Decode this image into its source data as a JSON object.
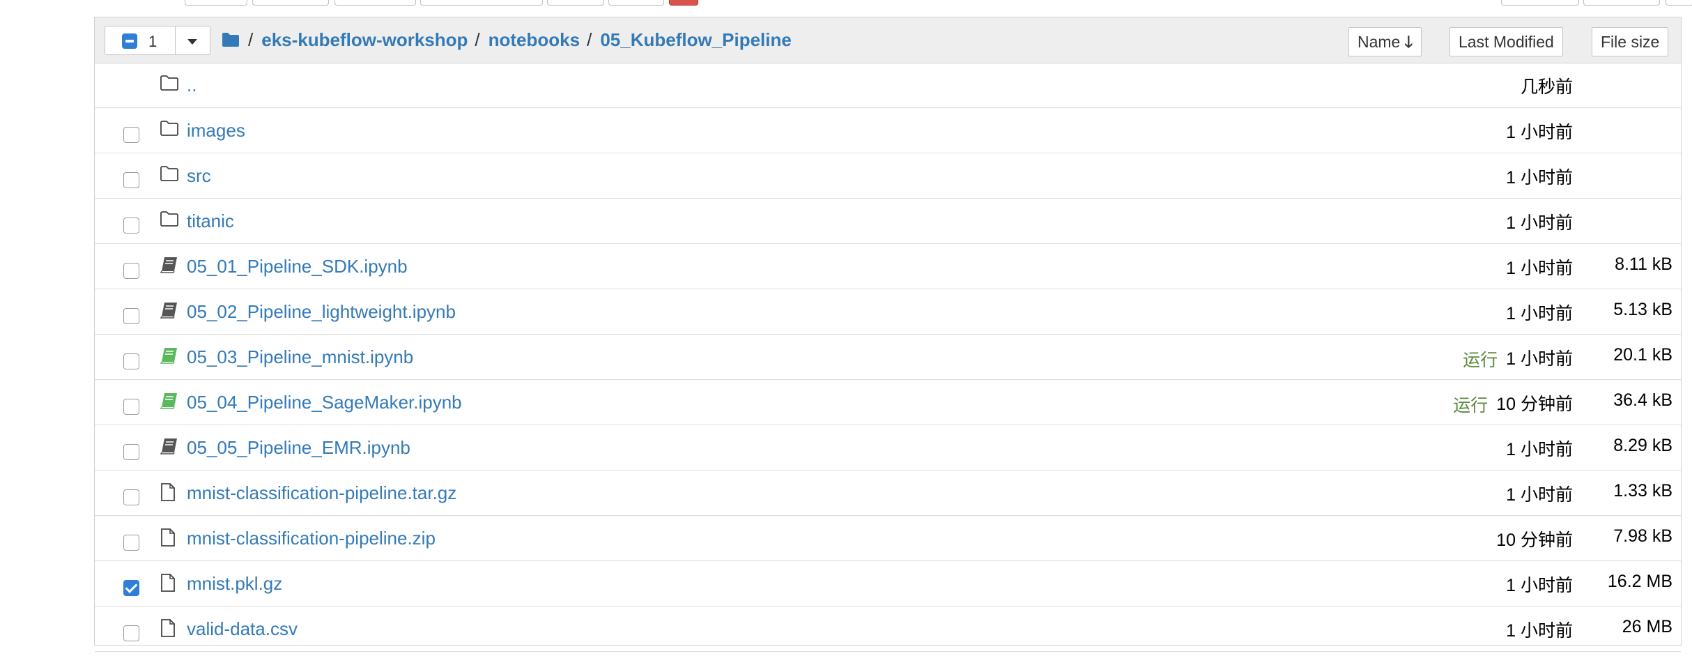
{
  "header": {
    "selected_count": "1",
    "breadcrumb": [
      {
        "label": "eks-kubeflow-workshop"
      },
      {
        "label": "notebooks"
      },
      {
        "label": "05_Kubeflow_Pipeline"
      }
    ],
    "breadcrumb_separator": "/",
    "sort_buttons": {
      "name": "Name",
      "last_modified": "Last Modified",
      "file_size": "File size"
    },
    "sort_direction_icon": "arrow-down-icon"
  },
  "rows": [
    {
      "type": "parent",
      "name": "..",
      "modified": "几秒前",
      "size": "",
      "running": "",
      "checked": false
    },
    {
      "type": "folder",
      "name": "images",
      "modified": "1 小时前",
      "size": "",
      "running": "",
      "checked": false
    },
    {
      "type": "folder",
      "name": "src",
      "modified": "1 小时前",
      "size": "",
      "running": "",
      "checked": false
    },
    {
      "type": "folder",
      "name": "titanic",
      "modified": "1 小时前",
      "size": "",
      "running": "",
      "checked": false
    },
    {
      "type": "notebook",
      "name": "05_01_Pipeline_SDK.ipynb",
      "modified": "1 小时前",
      "size": "8.11 kB",
      "running": "",
      "checked": false
    },
    {
      "type": "notebook",
      "name": "05_02_Pipeline_lightweight.ipynb",
      "modified": "1 小时前",
      "size": "5.13 kB",
      "running": "",
      "checked": false
    },
    {
      "type": "notebook-running",
      "name": "05_03_Pipeline_mnist.ipynb",
      "modified": "1 小时前",
      "size": "20.1 kB",
      "running": "运行",
      "checked": false
    },
    {
      "type": "notebook-running",
      "name": "05_04_Pipeline_SageMaker.ipynb",
      "modified": "10 分钟前",
      "size": "36.4 kB",
      "running": "运行",
      "checked": false
    },
    {
      "type": "notebook",
      "name": "05_05_Pipeline_EMR.ipynb",
      "modified": "1 小时前",
      "size": "8.29 kB",
      "running": "",
      "checked": false
    },
    {
      "type": "file",
      "name": "mnist-classification-pipeline.tar.gz",
      "modified": "1 小时前",
      "size": "1.33 kB",
      "running": "",
      "checked": false
    },
    {
      "type": "file",
      "name": "mnist-classification-pipeline.zip",
      "modified": "10 分钟前",
      "size": "7.98 kB",
      "running": "",
      "checked": false
    },
    {
      "type": "file",
      "name": "mnist.pkl.gz",
      "modified": "1 小时前",
      "size": "16.2 MB",
      "running": "",
      "checked": true
    },
    {
      "type": "file",
      "name": "valid-data.csv",
      "modified": "1 小时前",
      "size": "26 MB",
      "running": "",
      "checked": false
    }
  ],
  "colors": {
    "link": "#337ab7",
    "running": "#5b8a3c",
    "checkbox_checked": "#2f7fd8",
    "header_bg": "#eeeeee",
    "notebook_icon": "#555555",
    "notebook_running_icon": "#5cb85c"
  }
}
